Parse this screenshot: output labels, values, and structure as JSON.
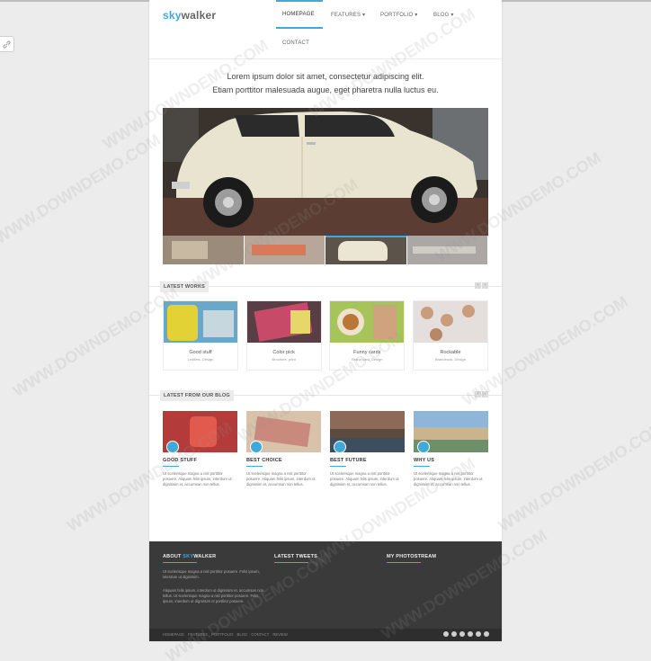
{
  "logo": {
    "part1": "sky",
    "part2": "walker"
  },
  "nav": [
    {
      "label": "HOMEPAGE"
    },
    {
      "label": "FEATURES ▾"
    },
    {
      "label": "PORTFOLIO ▾"
    },
    {
      "label": "BLOG ▾"
    },
    {
      "label": "CONTACT"
    }
  ],
  "intro": {
    "line1": "Lorem ipsum dolor sit amet, consectetur adipiscing elit.",
    "line2": "Etiam porttitor malesuada augue, eget pharetra nulla luctus eu."
  },
  "sections": {
    "works": "LATEST WORKS",
    "blog": "LATEST FROM OUR BLOG"
  },
  "works": [
    {
      "title": "Good stuff",
      "sub": "Leaflets, Design"
    },
    {
      "title": "Color pick",
      "sub": "Brochure, print"
    },
    {
      "title": "Funny cards",
      "sub": "Brand card, Design"
    },
    {
      "title": "Rockable",
      "sub": "Brandbook, Design"
    }
  ],
  "blog": [
    {
      "title": "GOOD STUFF",
      "text": "Ut scelerisque magna a nisl porttitor posuere. Aliquam felis ipsum, interdum ut dignissim et, accumsan non tellus."
    },
    {
      "title": "BEST CHOICE",
      "text": "Ut scelerisque magna a nisl porttitor posuere. Aliquam felis ipsum, interdum ut dignissim et, accumsan non tellus."
    },
    {
      "title": "BEST FUTURE",
      "text": "Ut scelerisque magna a nisl porttitor posuere. Aliquam felis ipsum, interdum ut dignissim et, accumsan non tellus."
    },
    {
      "title": "WHY US",
      "text": "Ut scelerisque magna a nisl porttitor posuere. Aliquam felis ipsum, interdum ut dignissim et, accumsan non tellus."
    }
  ],
  "footer": {
    "about_prefix": "ABOUT ",
    "about_accent": "SKY",
    "about_suffix": "WALKER",
    "tweets": "LATEST TWEETS",
    "photostream": "MY PHOTOSTREAM",
    "about_p1": "Ut scelerisque magna a nisl porttitor posuere. Felis ipsum, interdum ut dignissim.",
    "about_p2": "Aliquam felis ipsum, interdum ut dignissim et, accumsan non tellus. Ut scelerisque magna a nisl porttitor posuere. Felis ipsum, interdum ut dignissim et porttitor posuere.",
    "bottom_links": "HOMEPAGE FEATURES PORTFOLIO BLOG CONTACT REVIEW"
  },
  "watermark": "WWW.DOWNDEMO.COM",
  "colors": {
    "accent": "#3fa9d9",
    "footer_bg": "#3a3a3a"
  }
}
